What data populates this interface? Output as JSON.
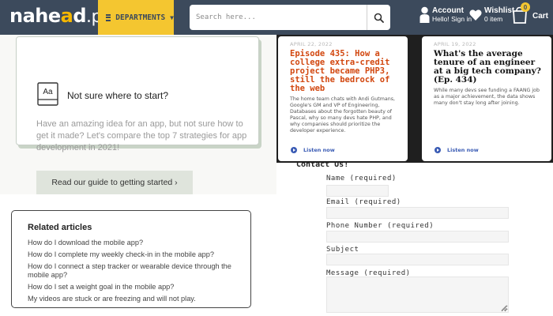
{
  "header": {
    "logo_left": "nahe",
    "logo_accent": "a",
    "logo_right": "d",
    "logo_domain": ".pk",
    "departments_label": "DEPARTMENTS",
    "search_placeholder": "Search here...",
    "account_title": "Account",
    "account_sub": "Hello! Sign in",
    "wishlist_title": "Wishlist",
    "wishlist_sub": "0 item",
    "cart_count": "0",
    "cart_label": "Cart",
    "bar_color": "#3c4a5c",
    "accent_color": "#f4c630"
  },
  "promo": {
    "title": "Not sure where to start?",
    "text": "Have an amazing idea for an app, but not sure how to get it made? Let's compare the top 7 strategies for app development in 2021!",
    "button_label": "Read our guide to getting started ›"
  },
  "related": {
    "heading": "Related articles",
    "items": [
      "How do I download the mobile app?",
      "How do I complete my weekly check-in in the mobile app?",
      "How do I connect a step tracker or wearable device through the mobile app?",
      "How do I set a weight goal in the mobile app?",
      "My videos are stuck or are freezing and will not play."
    ]
  },
  "episodes": [
    {
      "date": "APRIL 22, 2022",
      "title": "Episode 435: How a college extra-credit project became PHP3, still the bedrock of the web",
      "desc": "The home team chats with Andi Gutmans, Google's GM and VP of Engineering, Databases about the forgotten beauty of Pascal, why so many devs hate PHP, and why companies should prioritize the developer experience.",
      "listen": "Listen now"
    },
    {
      "date": "APRIL 19, 2022",
      "title": "What's the average tenure of an engineer at a big tech company? (Ep. 434)",
      "desc": "While many devs see funding a FAANG job as a major achievement, the data shows many don't stay long after joining.",
      "listen": "Listen now"
    }
  ],
  "contact": {
    "title": "Contact Us!",
    "name_label": "Name (required)",
    "email_label": "Email (required)",
    "phone_label": "Phone Number (required)",
    "subject_label": "Subject",
    "message_label": "Message (required)"
  }
}
